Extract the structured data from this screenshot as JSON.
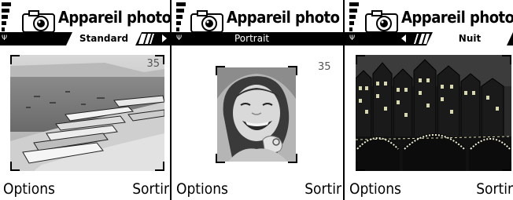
{
  "screens": [
    {
      "title": "Appareil photo",
      "mode": "Standard",
      "count": "35",
      "left_softkey": "Options",
      "right_softkey": "Sortir",
      "scene": "beach-boats"
    },
    {
      "title": "Appareil photo",
      "mode": "Portrait",
      "count": "35",
      "left_softkey": "Options",
      "right_softkey": "Sortir",
      "scene": "portrait-woman"
    },
    {
      "title": "Appareil photo",
      "mode": "Nuit",
      "count": "",
      "left_softkey": "Options",
      "right_softkey": "Sortir",
      "scene": "night-canal-bridge"
    }
  ],
  "icons": {
    "signal": "signal-strength-icon",
    "antenna": "antenna-icon",
    "camera": "camera-icon",
    "next": "arrow-right-icon",
    "prev": "arrow-left-icon"
  }
}
